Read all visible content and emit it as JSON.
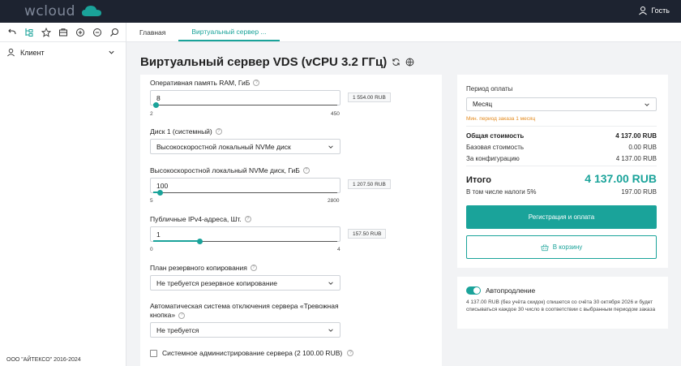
{
  "app": {
    "logo_text": "wcloud",
    "user_label": "Гость",
    "accent": "#1aa39a",
    "copyright": "ООО \"АЙТЕКСО\" 2016-2024"
  },
  "sidebar": {
    "tools": [
      "back-icon",
      "tree-icon",
      "star-icon",
      "folder-icon",
      "zoom-in-icon",
      "zoom-out-icon",
      "search-icon"
    ],
    "client_label": "Клиент"
  },
  "tabs": [
    {
      "label": "Главная",
      "active": false
    },
    {
      "label": "Виртуальный сервер ...",
      "active": true
    }
  ],
  "page": {
    "title": "Виртуальный сервер VDS (vCPU 3.2 ГГц)"
  },
  "form": {
    "ram": {
      "label": "Оперативная память RAM, ГиБ",
      "value": "8",
      "min": "2",
      "max": "450",
      "price": "1 554.00 RUB",
      "fraction": 0.013
    },
    "disk_type": {
      "label": "Диск 1 (системный)",
      "value": "Высокоскоростной локальный NVMe диск"
    },
    "disk_size": {
      "label": "Высокоскоростной локальный NVMe диск, ГиБ",
      "value": "100",
      "min": "5",
      "max": "2800",
      "price": "1 207.50 RUB",
      "fraction": 0.034
    },
    "ipv4": {
      "label": "Публичные IPv4-адреса, Шт.",
      "value": "1",
      "min": "0",
      "max": "4",
      "price": "157.50 RUB",
      "fraction": 0.25
    },
    "backup": {
      "label": "План резервного копирования",
      "value": "Не требуется резервное копирование"
    },
    "panic": {
      "label_line1": "Автоматическая система отключения сервера «Тревожная",
      "label_line2": "кнопка»",
      "value": "Не требуется"
    },
    "admin": {
      "label": "Системное администрирование сервера (2 100.00 RUB)",
      "checked": false
    }
  },
  "summary": {
    "period_label": "Период оплаты",
    "period_value": "Месяц",
    "min_note": "Мин. период заказа 1 месяц",
    "total_cost_label": "Общая стоимость",
    "total_cost_value": "4 137.00 RUB",
    "base_cost_label": "Базовая стоимость",
    "base_cost_value": "0.00 RUB",
    "config_cost_label": "За конфигурацию",
    "config_cost_value": "4 137.00 RUB",
    "itogo_label": "Итого",
    "itogo_value": "4 137.00 RUB",
    "tax_label": "В том числе налоги 5%",
    "tax_value": "197.00 RUB",
    "register_btn": "Регистрация и оплата",
    "cart_btn": "В корзину"
  },
  "autorenew": {
    "label": "Автопродление",
    "enabled": true,
    "text": "4 137.00 RUB (без учёта скидок) спишется со счёта 30 октября 2026 и будет списываться каждое 30 число в соответствии с выбранным периодом заказа"
  }
}
